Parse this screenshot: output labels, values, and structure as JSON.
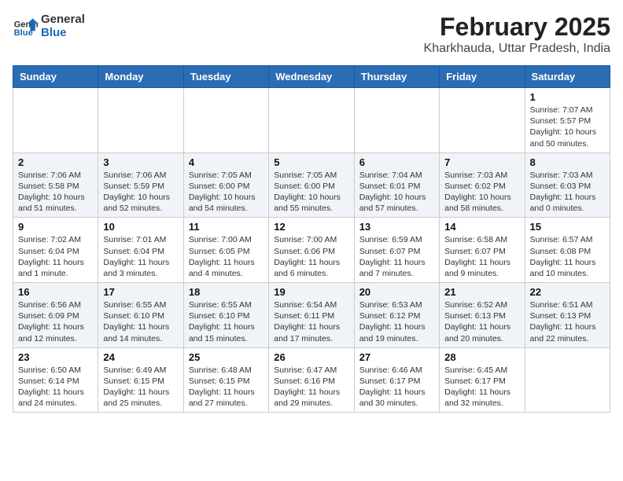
{
  "header": {
    "logo_general": "General",
    "logo_blue": "Blue",
    "month": "February 2025",
    "location": "Kharkhauda, Uttar Pradesh, India"
  },
  "days_of_week": [
    "Sunday",
    "Monday",
    "Tuesday",
    "Wednesday",
    "Thursday",
    "Friday",
    "Saturday"
  ],
  "weeks": [
    [
      {
        "day": "",
        "info": ""
      },
      {
        "day": "",
        "info": ""
      },
      {
        "day": "",
        "info": ""
      },
      {
        "day": "",
        "info": ""
      },
      {
        "day": "",
        "info": ""
      },
      {
        "day": "",
        "info": ""
      },
      {
        "day": "1",
        "info": "Sunrise: 7:07 AM\nSunset: 5:57 PM\nDaylight: 10 hours and 50 minutes."
      }
    ],
    [
      {
        "day": "2",
        "info": "Sunrise: 7:06 AM\nSunset: 5:58 PM\nDaylight: 10 hours and 51 minutes."
      },
      {
        "day": "3",
        "info": "Sunrise: 7:06 AM\nSunset: 5:59 PM\nDaylight: 10 hours and 52 minutes."
      },
      {
        "day": "4",
        "info": "Sunrise: 7:05 AM\nSunset: 6:00 PM\nDaylight: 10 hours and 54 minutes."
      },
      {
        "day": "5",
        "info": "Sunrise: 7:05 AM\nSunset: 6:00 PM\nDaylight: 10 hours and 55 minutes."
      },
      {
        "day": "6",
        "info": "Sunrise: 7:04 AM\nSunset: 6:01 PM\nDaylight: 10 hours and 57 minutes."
      },
      {
        "day": "7",
        "info": "Sunrise: 7:03 AM\nSunset: 6:02 PM\nDaylight: 10 hours and 58 minutes."
      },
      {
        "day": "8",
        "info": "Sunrise: 7:03 AM\nSunset: 6:03 PM\nDaylight: 11 hours and 0 minutes."
      }
    ],
    [
      {
        "day": "9",
        "info": "Sunrise: 7:02 AM\nSunset: 6:04 PM\nDaylight: 11 hours and 1 minute."
      },
      {
        "day": "10",
        "info": "Sunrise: 7:01 AM\nSunset: 6:04 PM\nDaylight: 11 hours and 3 minutes."
      },
      {
        "day": "11",
        "info": "Sunrise: 7:00 AM\nSunset: 6:05 PM\nDaylight: 11 hours and 4 minutes."
      },
      {
        "day": "12",
        "info": "Sunrise: 7:00 AM\nSunset: 6:06 PM\nDaylight: 11 hours and 6 minutes."
      },
      {
        "day": "13",
        "info": "Sunrise: 6:59 AM\nSunset: 6:07 PM\nDaylight: 11 hours and 7 minutes."
      },
      {
        "day": "14",
        "info": "Sunrise: 6:58 AM\nSunset: 6:07 PM\nDaylight: 11 hours and 9 minutes."
      },
      {
        "day": "15",
        "info": "Sunrise: 6:57 AM\nSunset: 6:08 PM\nDaylight: 11 hours and 10 minutes."
      }
    ],
    [
      {
        "day": "16",
        "info": "Sunrise: 6:56 AM\nSunset: 6:09 PM\nDaylight: 11 hours and 12 minutes."
      },
      {
        "day": "17",
        "info": "Sunrise: 6:55 AM\nSunset: 6:10 PM\nDaylight: 11 hours and 14 minutes."
      },
      {
        "day": "18",
        "info": "Sunrise: 6:55 AM\nSunset: 6:10 PM\nDaylight: 11 hours and 15 minutes."
      },
      {
        "day": "19",
        "info": "Sunrise: 6:54 AM\nSunset: 6:11 PM\nDaylight: 11 hours and 17 minutes."
      },
      {
        "day": "20",
        "info": "Sunrise: 6:53 AM\nSunset: 6:12 PM\nDaylight: 11 hours and 19 minutes."
      },
      {
        "day": "21",
        "info": "Sunrise: 6:52 AM\nSunset: 6:13 PM\nDaylight: 11 hours and 20 minutes."
      },
      {
        "day": "22",
        "info": "Sunrise: 6:51 AM\nSunset: 6:13 PM\nDaylight: 11 hours and 22 minutes."
      }
    ],
    [
      {
        "day": "23",
        "info": "Sunrise: 6:50 AM\nSunset: 6:14 PM\nDaylight: 11 hours and 24 minutes."
      },
      {
        "day": "24",
        "info": "Sunrise: 6:49 AM\nSunset: 6:15 PM\nDaylight: 11 hours and 25 minutes."
      },
      {
        "day": "25",
        "info": "Sunrise: 6:48 AM\nSunset: 6:15 PM\nDaylight: 11 hours and 27 minutes."
      },
      {
        "day": "26",
        "info": "Sunrise: 6:47 AM\nSunset: 6:16 PM\nDaylight: 11 hours and 29 minutes."
      },
      {
        "day": "27",
        "info": "Sunrise: 6:46 AM\nSunset: 6:17 PM\nDaylight: 11 hours and 30 minutes."
      },
      {
        "day": "28",
        "info": "Sunrise: 6:45 AM\nSunset: 6:17 PM\nDaylight: 11 hours and 32 minutes."
      },
      {
        "day": "",
        "info": ""
      }
    ]
  ]
}
